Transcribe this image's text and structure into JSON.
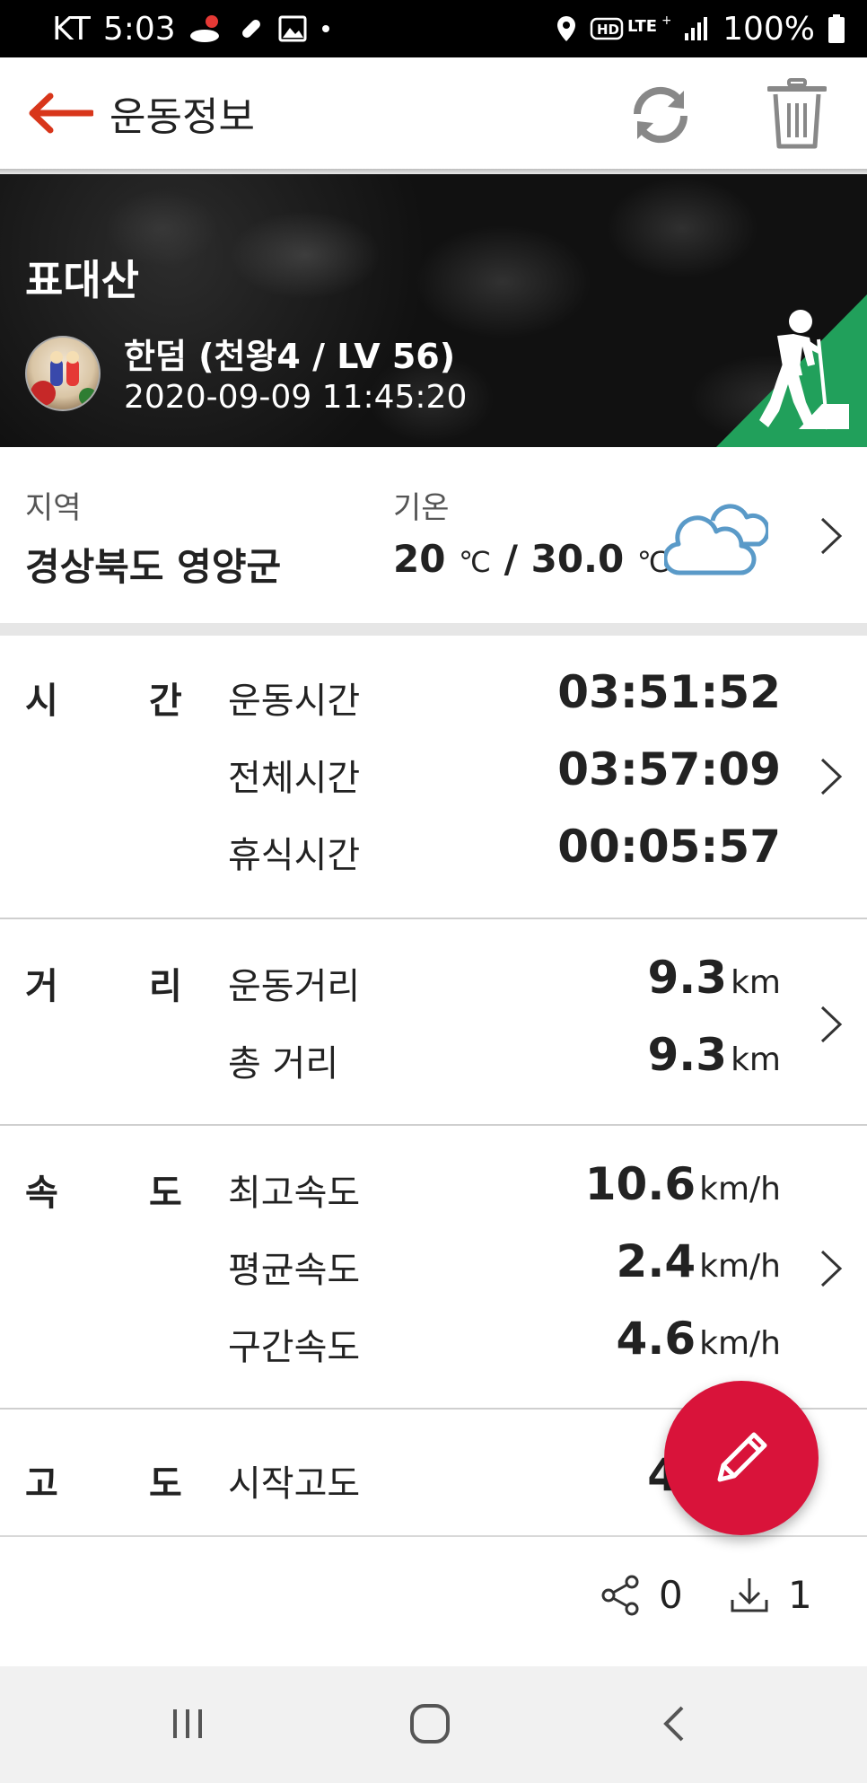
{
  "status_bar": {
    "carrier": "KT",
    "time": "5:03",
    "battery": "100%"
  },
  "app_bar": {
    "title": "운동정보"
  },
  "banner": {
    "mountain": "표대산",
    "user": "한덤 (천왕4 / LV 56)",
    "datetime": "2020-09-09 11:45:20",
    "activity_icon": "hiking-icon",
    "accent_color": "#21a05b"
  },
  "info": {
    "region_label": "지역",
    "region_value": "경상북도 영양군",
    "temp_label": "기온",
    "temp_low": "20",
    "temp_high": "30.0",
    "temp_unit": "℃",
    "temp_sep": "/",
    "weather": "cloudy-icon"
  },
  "time_section": {
    "label_a": "시",
    "label_b": "간",
    "rows": [
      {
        "label": "운동시간",
        "value": "03:51:52"
      },
      {
        "label": "전체시간",
        "value": "03:57:09"
      },
      {
        "label": "휴식시간",
        "value": "00:05:57"
      }
    ]
  },
  "distance_section": {
    "label_a": "거",
    "label_b": "리",
    "rows": [
      {
        "label": "운동거리",
        "value": "9.3",
        "unit": "km"
      },
      {
        "label": "총 거리",
        "value": "9.3",
        "unit": "km"
      }
    ]
  },
  "speed_section": {
    "label_a": "속",
    "label_b": "도",
    "rows": [
      {
        "label": "최고속도",
        "value": "10.6",
        "unit": "km/h"
      },
      {
        "label": "평균속도",
        "value": "2.4",
        "unit": "km/h"
      },
      {
        "label": "구간속도",
        "value": "4.6",
        "unit": "km/h"
      }
    ]
  },
  "altitude_section": {
    "label_a": "고",
    "label_b": "도",
    "rows": [
      {
        "label": "시작고도",
        "value": "4"
      }
    ]
  },
  "bottom": {
    "share_count": "0",
    "download_count": "1"
  },
  "colors": {
    "accent_red": "#d9133a",
    "back_arrow": "#d8361b",
    "weather_blue": "#5a9ac8"
  }
}
